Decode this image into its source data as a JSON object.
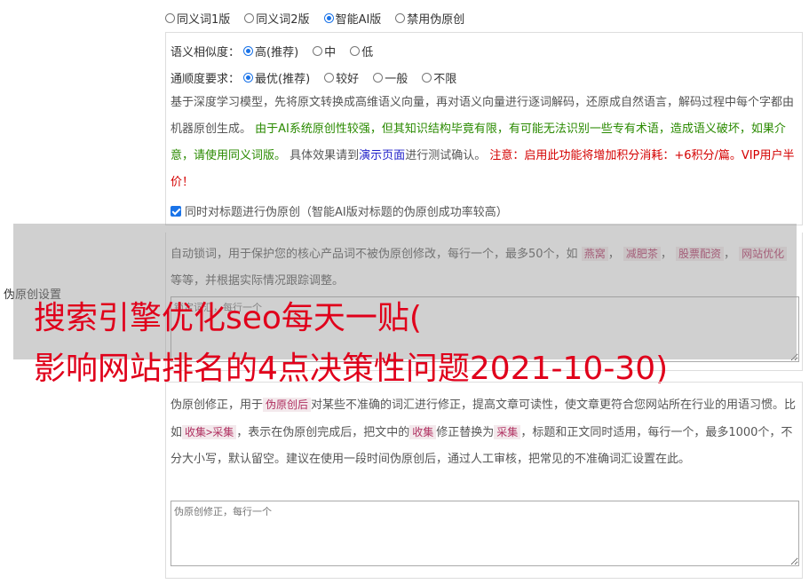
{
  "version_options": {
    "items": [
      {
        "label": "同义词1版",
        "selected": false
      },
      {
        "label": "同义词2版",
        "selected": false
      },
      {
        "label": "智能AI版",
        "selected": true
      },
      {
        "label": "禁用伪原创",
        "selected": false
      }
    ]
  },
  "similarity": {
    "label": "语义相似度：",
    "options": [
      {
        "label": "高(推荐)",
        "selected": true
      },
      {
        "label": "中",
        "selected": false
      },
      {
        "label": "低",
        "selected": false
      }
    ]
  },
  "fluency": {
    "label": "通顺度要求：",
    "options": [
      {
        "label": "最优(推荐)",
        "selected": true
      },
      {
        "label": "较好",
        "selected": false
      },
      {
        "label": "一般",
        "selected": false
      },
      {
        "label": "不限",
        "selected": false
      }
    ]
  },
  "description": {
    "part1": "基于深度学习模型，先将原文转换成高维语义向量，再对语义向量进行逐词解码，还原成自然语言，解码过程中每个字都由机器原创生成。",
    "part2_green": "由于AI系统原创性较强，但其知识结构毕竟有限，有可能无法识别一些专有术语，造成语义破坏，如果介意，请使用同义词版。",
    "part3": "具体效果请到",
    "link": "演示页面",
    "part4": "进行测试确认。",
    "warning": "注意：启用此功能将增加积分消耗：+6积分/篇。VIP用户半价！"
  },
  "title_checkbox": {
    "label": "同时对标题进行伪原创（智能AI版对标题的伪原创成功率较高）",
    "checked": true
  },
  "sidebar_label": "伪原创设置",
  "lock_words": {
    "intro": "自动锁词，用于保护您的核心产品词不被伪原创修改，每行一个，最多50个，如",
    "tags": [
      "燕窝",
      "减肥茶",
      "股票配资",
      "网站优化"
    ],
    "tail": "等等，并根据实际情况跟踪调整。",
    "placeholder": "锁定词汇，每行一个"
  },
  "corrections": {
    "intro": "伪原创修正，用于",
    "tag1": "伪原创后",
    "mid1": "对某些不准确的词汇进行修正，提高文章可读性，使文章更符合您网站所在行业的用语习惯。比如",
    "tag2": "收集>采集",
    "mid2": "，表示在伪原创完成后，把文中的",
    "tag3": "收集",
    "mid3": "修正替换为",
    "tag4": "采集",
    "tail": "，标题和正文同时适用，每行一个，最多1000个，不分大小写，默认留空。建议在使用一段时间伪原创后，通过人工审核，把常见的不准确词汇设置在此。",
    "placeholder": "伪原创修正，每行一个"
  },
  "overlay_headline": {
    "line1": "搜索引擎优化seo每天一贴(",
    "line2": "影响网站排名的4点决策性问题2021-10-30)"
  }
}
